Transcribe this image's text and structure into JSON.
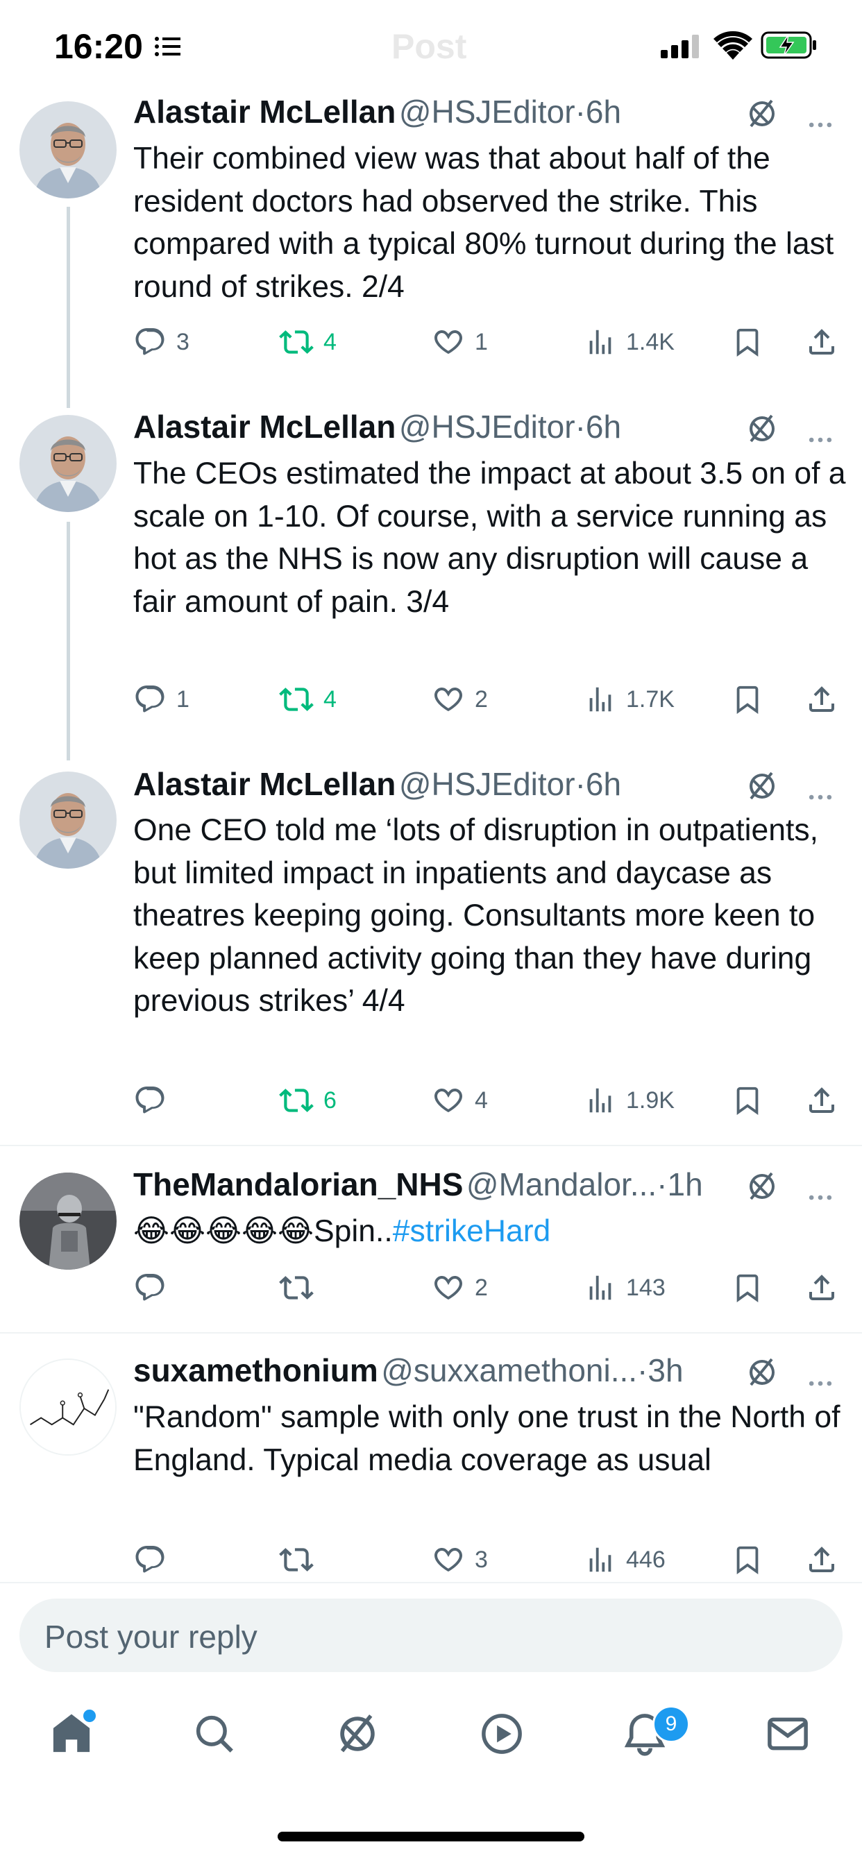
{
  "status_bar": {
    "time": "16:20",
    "title": "Post"
  },
  "tweets": [
    {
      "name": "Alastair McLellan",
      "handle": "@HSJEditor",
      "age": "6h",
      "text": "Their combined view was that about half of the resident doctors had observed the strike. This compared with a typical 80% turnout during the last round of strikes. 2/4",
      "replies": "3",
      "reposts": "4",
      "likes": "1",
      "views": "1.4K"
    },
    {
      "name": "Alastair McLellan",
      "handle": "@HSJEditor",
      "age": "6h",
      "text": "The CEOs estimated the impact at about 3.5 on of a scale on 1-10. Of course, with a service running as hot as the NHS is now any disruption will cause a fair amount of pain. 3/4",
      "replies": "1",
      "reposts": "4",
      "likes": "2",
      "views": "1.7K"
    },
    {
      "name": "Alastair McLellan",
      "handle": "@HSJEditor",
      "age": "6h",
      "text": "One CEO told me ‘lots of disruption in outpatients, but limited impact in inpatients and daycase as theatres keeping going. Consultants more keen to keep planned activity going than they have during previous strikes’ 4/4",
      "replies": "",
      "reposts": "6",
      "likes": "4",
      "views": "1.9K"
    },
    {
      "name": "TheMandalorian_NHS",
      "handle": "@Mandalor...",
      "age": "1h",
      "text": "😂😂😂😂😂Spin..",
      "hashtag": "#strikeHard",
      "replies": "",
      "reposts": "",
      "likes": "2",
      "views": "143"
    },
    {
      "name": "suxamethonium",
      "handle": "@suxxamethoni...",
      "age": "3h",
      "text": "\"Random\" sample with only one trust in the North of England.  Typical media coverage as usual",
      "replies": "",
      "reposts": "",
      "likes": "3",
      "views": "446"
    }
  ],
  "reply_bar": {
    "placeholder": "Post your reply"
  },
  "tab_bar": {
    "items": [
      "home-icon",
      "search-icon",
      "grok-icon",
      "video-icon",
      "notifications-icon",
      "messages-icon"
    ],
    "notification_count": "9"
  },
  "colors": {
    "accent": "#1d9bf0",
    "repost_green": "#00ba7c",
    "secondary_text": "#536471"
  }
}
